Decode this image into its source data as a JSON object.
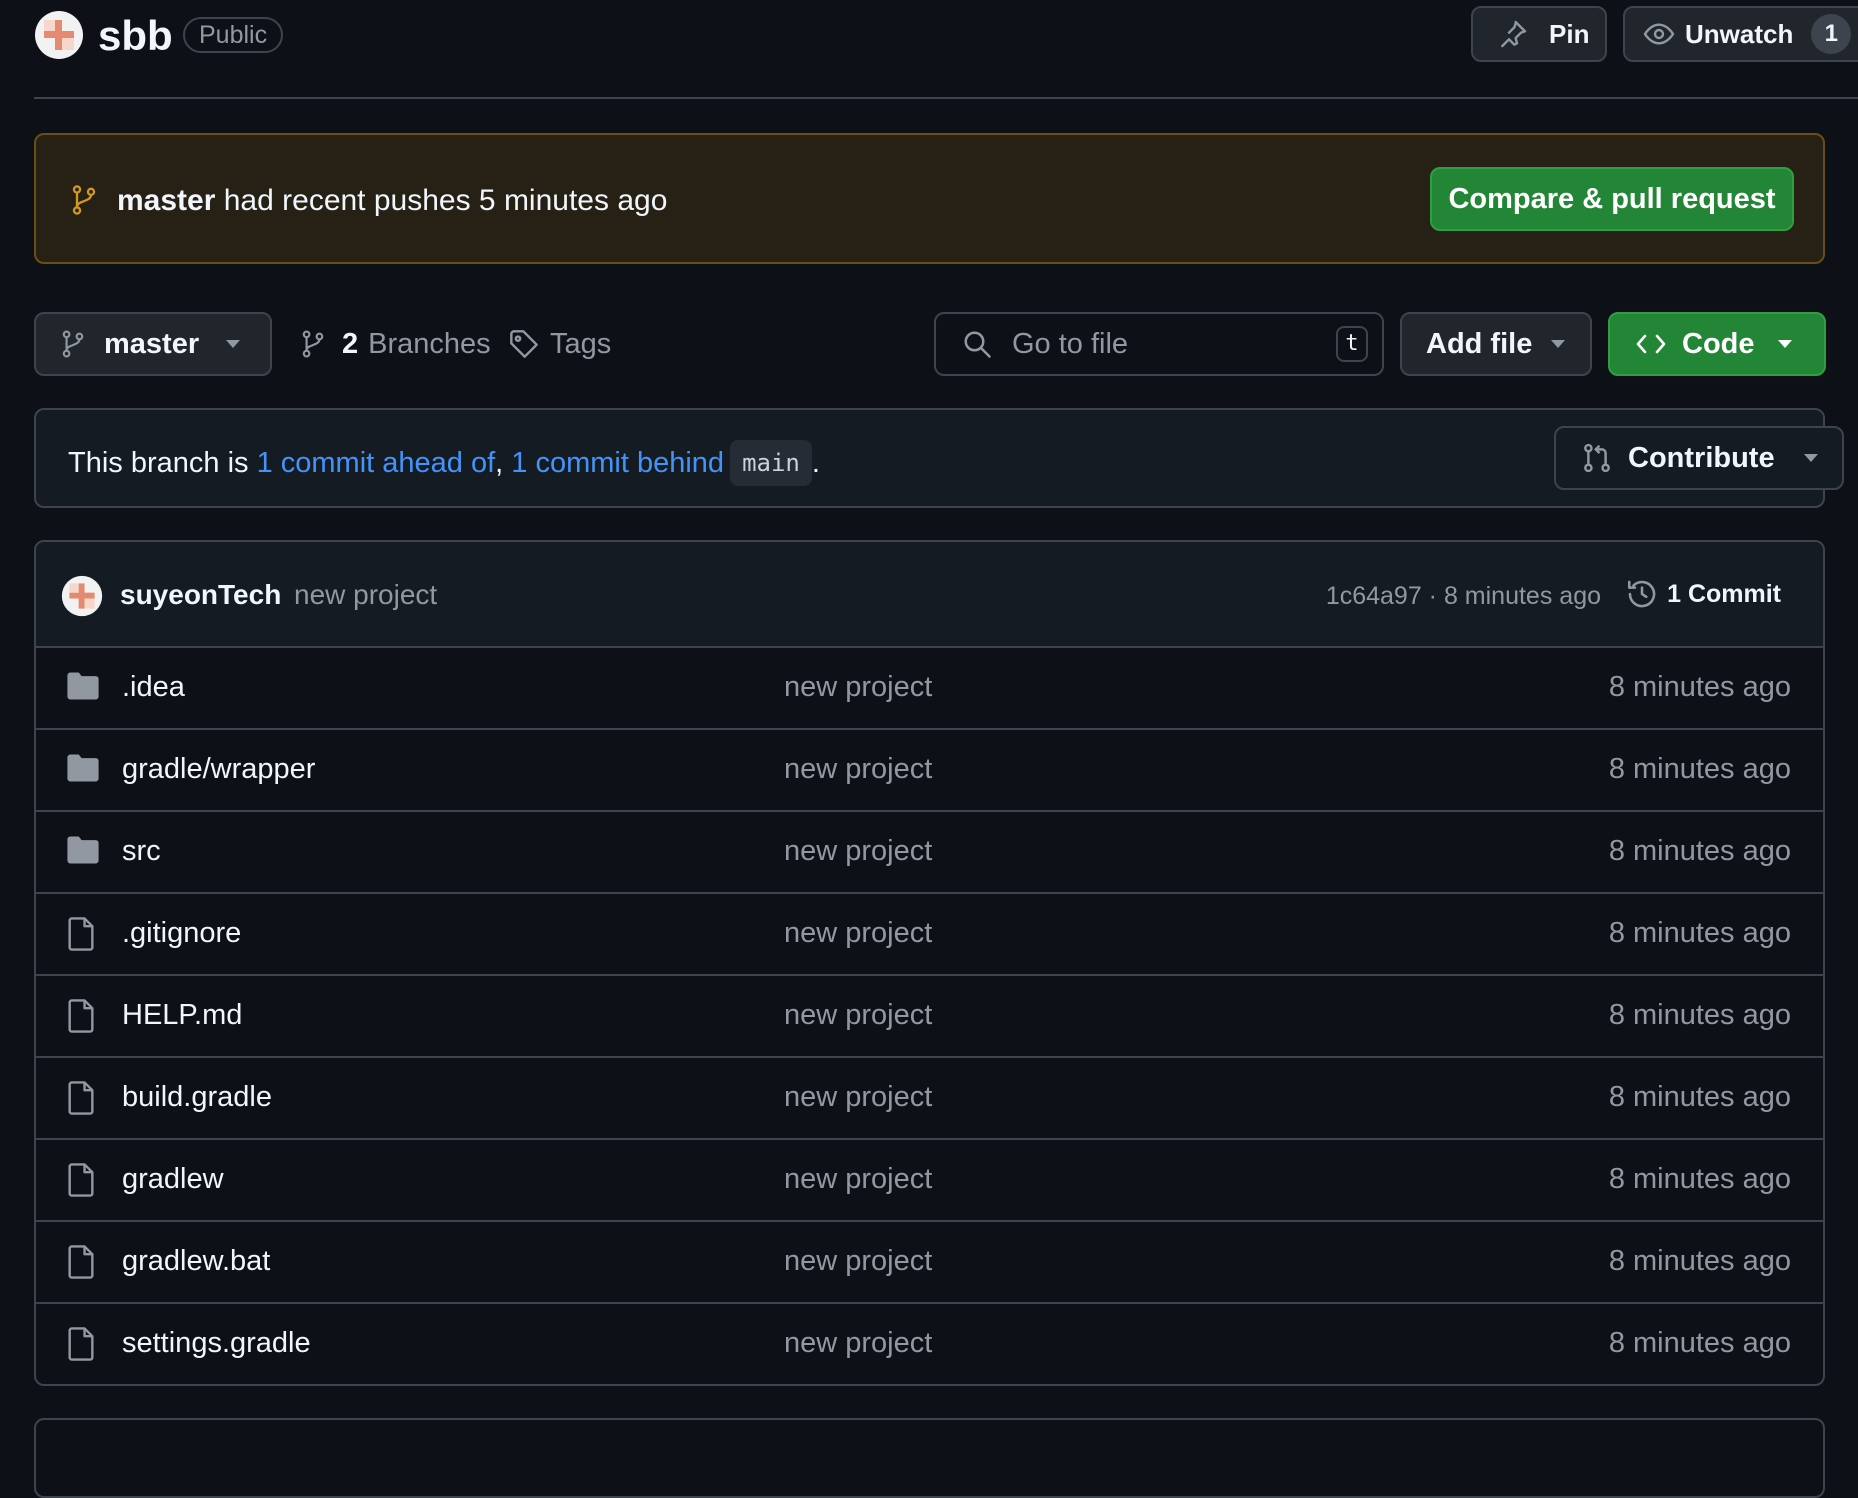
{
  "header": {
    "repo_name": "sbb",
    "visibility": "Public",
    "pin_label": "Pin",
    "unwatch_label": "Unwatch",
    "watch_count": "1"
  },
  "banner": {
    "branch": "master",
    "text": "had recent pushes 5 minutes ago",
    "button_label": "Compare & pull request"
  },
  "toolbar": {
    "branch": "master",
    "branches_count": "2",
    "branches_label": "Branches",
    "tags_label": "Tags",
    "search_placeholder": "Go to file",
    "search_shortcut": "t",
    "add_file_label": "Add file",
    "code_label": "Code"
  },
  "branch_status": {
    "prefix": "This branch is",
    "ahead": "1 commit ahead of",
    "separator": ",",
    "behind": "1 commit behind",
    "base": "main",
    "suffix": ".",
    "contribute_label": "Contribute"
  },
  "latest_commit": {
    "author": "suyeonTech",
    "message": "new project",
    "meta": "1c64a97 · 8 minutes ago",
    "history_label": "1 Commit"
  },
  "files": [
    {
      "name": ".idea",
      "type": "folder",
      "message": "new project",
      "time": "8 minutes ago"
    },
    {
      "name": "gradle/wrapper",
      "type": "folder",
      "message": "new project",
      "time": "8 minutes ago"
    },
    {
      "name": "src",
      "type": "folder",
      "message": "new project",
      "time": "8 minutes ago"
    },
    {
      "name": ".gitignore",
      "type": "file",
      "message": "new project",
      "time": "8 minutes ago"
    },
    {
      "name": "HELP.md",
      "type": "file",
      "message": "new project",
      "time": "8 minutes ago"
    },
    {
      "name": "build.gradle",
      "type": "file",
      "message": "new project",
      "time": "8 minutes ago"
    },
    {
      "name": "gradlew",
      "type": "file",
      "message": "new project",
      "time": "8 minutes ago"
    },
    {
      "name": "gradlew.bat",
      "type": "file",
      "message": "new project",
      "time": "8 minutes ago"
    },
    {
      "name": "settings.gradle",
      "type": "file",
      "message": "new project",
      "time": "8 minutes ago"
    }
  ],
  "icons": {
    "folder": "folder-icon",
    "file": "file-icon"
  },
  "colors": {
    "accent_green": "#238636",
    "link_blue": "#4493f8",
    "banner_bg": "#272115",
    "banner_border": "#6b4d16"
  }
}
